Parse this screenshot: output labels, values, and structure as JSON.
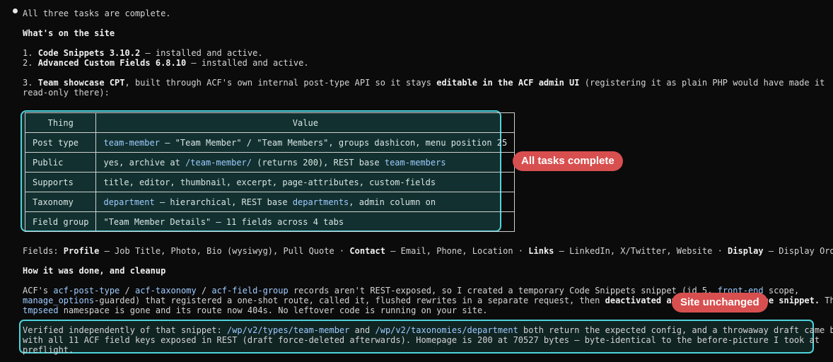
{
  "intro": "All three tasks are complete.",
  "whats_heading": "What's on the site",
  "item1": {
    "num": "1. ",
    "bold": "Code Snippets 3.10.2",
    "rest": " — installed and active."
  },
  "item2": {
    "num": "2. ",
    "bold": "Advanced Custom Fields 6.8.10",
    "rest": " — installed and active."
  },
  "item3": {
    "num": "3. ",
    "bold1": "Team showcase CPT",
    "mid": ", built through ACF's own internal post-type API so it stays ",
    "bold2": "editable in the ACF admin UI",
    "tail": " (registering it as plain PHP would have made it",
    "line2": "read-only there):"
  },
  "table": {
    "headers": [
      "Thing",
      "Value"
    ],
    "rows": [
      {
        "thing": "Post type",
        "v_code": "team-member",
        "v_rest": " — \"Team Member\" / \"Team Members\", groups dashicon, menu position 25"
      },
      {
        "thing": "Public",
        "v_pre": "yes, archive at ",
        "v_code": "/team-member/",
        "v_mid": " (returns 200), REST base ",
        "v_code2": "team-members"
      },
      {
        "thing": "Supports",
        "v_text": "title, editor, thumbnail, excerpt, page-attributes, custom-fields"
      },
      {
        "thing": "Taxonomy",
        "v_code": "department",
        "v_mid": " — hierarchical, REST base ",
        "v_code2": "departments",
        "v_rest": ", admin column on"
      },
      {
        "thing": "Field group",
        "v_text": "\"Team Member Details\" — 11 fields across 4 tabs"
      }
    ]
  },
  "callouts": {
    "tasks": "All tasks complete",
    "site": "Site unchanged"
  },
  "fields": {
    "label": "Fields: ",
    "g1": "Profile",
    "g1_text": " — Job Title, Photo, Bio (wysiwyg), Pull Quote · ",
    "g2": "Contact",
    "g2_text": " — Email, Phone, Location · ",
    "g3": "Links",
    "g3_text": " — LinkedIn, X/Twitter, Website · ",
    "g4": "Display",
    "g4_text": " — Display Order."
  },
  "how_heading": "How it was done, and cleanup",
  "how": {
    "l1_pre": "ACF's ",
    "c1": "acf-post-type",
    "s1": " / ",
    "c2": "acf-taxonomy",
    "s2": " / ",
    "c3": "acf-field-group",
    "l1_mid": " records aren't REST-exposed, so I created a temporary Code Snippets snippet (id 5, ",
    "c4": "front-end",
    "l1_end": " scope,",
    "c5": "manage_options",
    "l2_mid": "-guarded) that registered a one-shot route, called it, flushed rewrites in a separate request, then ",
    "b1": "deactivated and f",
    "b_hidden": "ully deleted the snippe",
    "b2": "t.",
    "l2_end": " The",
    "c6": "tmpseed",
    "l3_rest": " namespace is gone and its route now 404s. No leftover code is running on your site."
  },
  "verify": {
    "l1_pre": "Verified independently of that snippet: ",
    "c1": "/wp/v2/types/team-member",
    "l1_mid": " and ",
    "c2": "/wp/v2/taxonomies/department",
    "l1_end": " both return the expected config, and a throwaway draft came back",
    "l2": "with all 11 ACF field keys exposed in REST (draft force-deleted afterwards). Homepage is 200 at 70527 bytes — byte-identical to the before-picture I took at",
    "l3": "preflight."
  }
}
